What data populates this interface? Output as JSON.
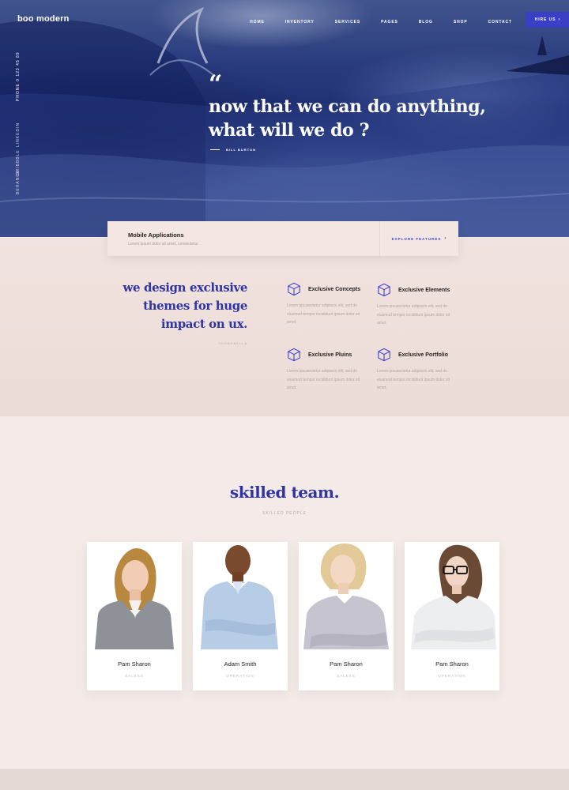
{
  "header": {
    "logo": "boo modern",
    "nav": [
      "HOME",
      "INVENTORY",
      "SERVICES",
      "PAGES",
      "BLOG",
      "SHOP",
      "CONTACT"
    ],
    "cta": "HIRE US",
    "cta_icon": "chevron-right-icon"
  },
  "side_social": [
    "PHONE 0 123 45 89",
    "LINKEDIN",
    "DRIBBBLE",
    "BEHANCE"
  ],
  "hero": {
    "quote_mark": "“",
    "quote_line1": "now that we can do anything,",
    "quote_line2": "what will we do ?",
    "author": "BILL BURTON"
  },
  "feature_bar": {
    "title": "Mobile Applications",
    "subtitle": "Lorem ipsum dolor sit amet, consectetur.",
    "link": "EXPLORE FEATURES",
    "link_icon": "chevron-right-icon"
  },
  "design": {
    "heading_line1": "we design exclusive",
    "heading_line2": "themes for huge",
    "heading_line3": "impact on ux.",
    "signature": "- TOOMEBELLA",
    "features": [
      {
        "title": "Exclusive Concepts",
        "icon": "cube-icon",
        "desc": "Lorem ipsusectetur adipiscin elit, sed do eiusmod tempor incididunt ipsum dolor sit amet."
      },
      {
        "title": "Exclusive Elements",
        "icon": "cube-icon",
        "desc": "Lorem ipsusectetur adipiscin elit, sed do eiusmod tempor incididunt ipsum dolor sit amet."
      },
      {
        "title": "Exclusive Pluins",
        "icon": "cube-icon",
        "desc": "Lorem ipsusectetur adipiscin elit, sed do eiusmod tempor incididunt ipsum dolor sit amet."
      },
      {
        "title": "Exclusive Portfolio",
        "icon": "cube-icon",
        "desc": "Lorem ipsusectetur adipiscin elit, sed do eiusmod tempor incididunt ipsum dolor sit amet."
      }
    ]
  },
  "team": {
    "title": "skilled team.",
    "subtitle": "SKILLED PEOPLE",
    "members": [
      {
        "name": "Pam Sharon",
        "role": "SALESS"
      },
      {
        "name": "Adam Smith",
        "role": "OPERATION"
      },
      {
        "name": "Pam Sharon",
        "role": "SALESS"
      },
      {
        "name": "Pam Sharon",
        "role": "OPERATION"
      }
    ]
  },
  "colors": {
    "accent": "#3035a4",
    "button": "#3b3fc6",
    "section_bg": "#f4ebe8"
  }
}
